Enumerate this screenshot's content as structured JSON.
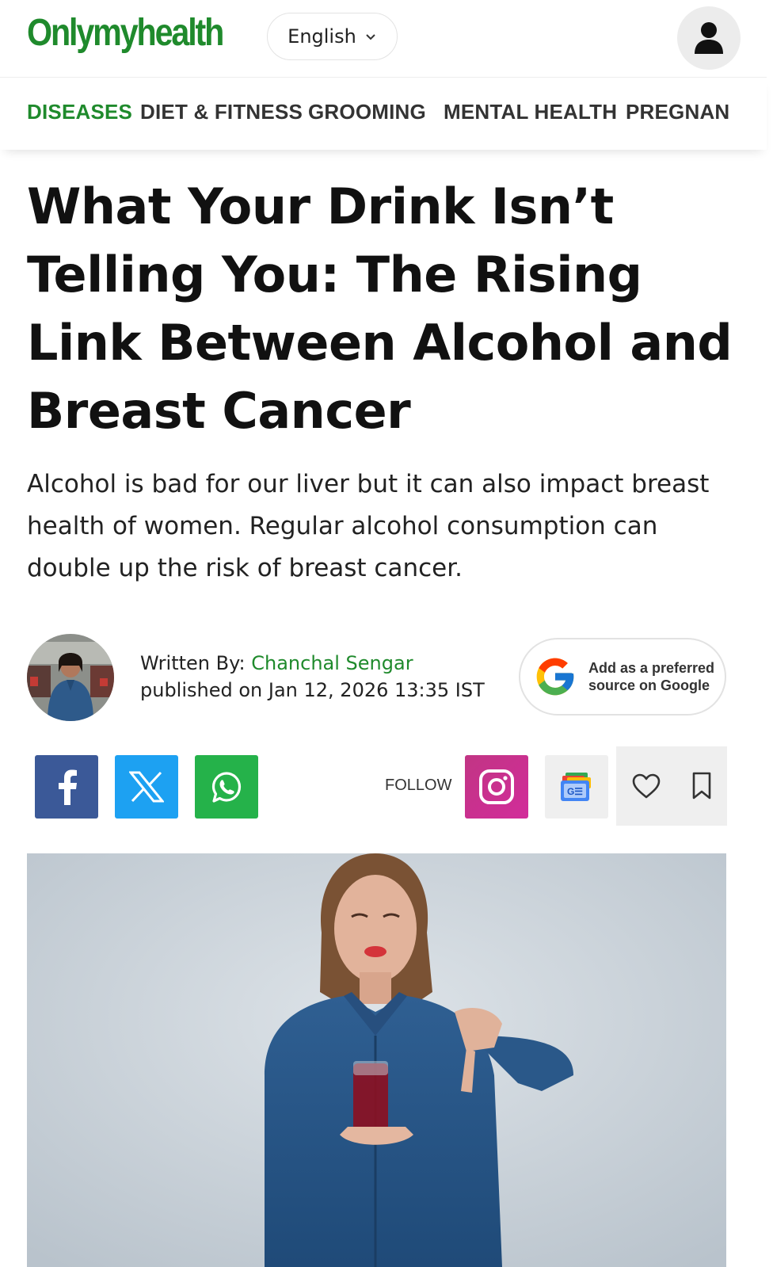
{
  "header": {
    "logo": "Onlymyhealth",
    "language": "English"
  },
  "nav": {
    "items": [
      "DISEASES",
      "DIET & FITNESS",
      "GROOMING",
      "MENTAL HEALTH",
      "PREGNAN"
    ]
  },
  "article": {
    "headline": "What Your Drink Isn’t Telling You: The Rising Link Between Alcohol and Breast Cancer",
    "summary": "Alcohol is bad for our liver but it can also impact breast health of women. Regular alcohol consumption can double up the risk of breast cancer.",
    "author_prefix": "Written By: ",
    "author_name": "Chanchal Sengar",
    "published": "published on Jan 12, 2026 13:35 IST"
  },
  "google_pref": {
    "line1": "Add as a preferred",
    "line2": "source on Google"
  },
  "share": {
    "follow_label": "FOLLOW"
  },
  "icons": {
    "brand_green": "#1f8a2c",
    "facebook": "#3b5998",
    "twitter": "#1da1f2",
    "whatsapp": "#25b24a",
    "instagram": "#c13584"
  }
}
